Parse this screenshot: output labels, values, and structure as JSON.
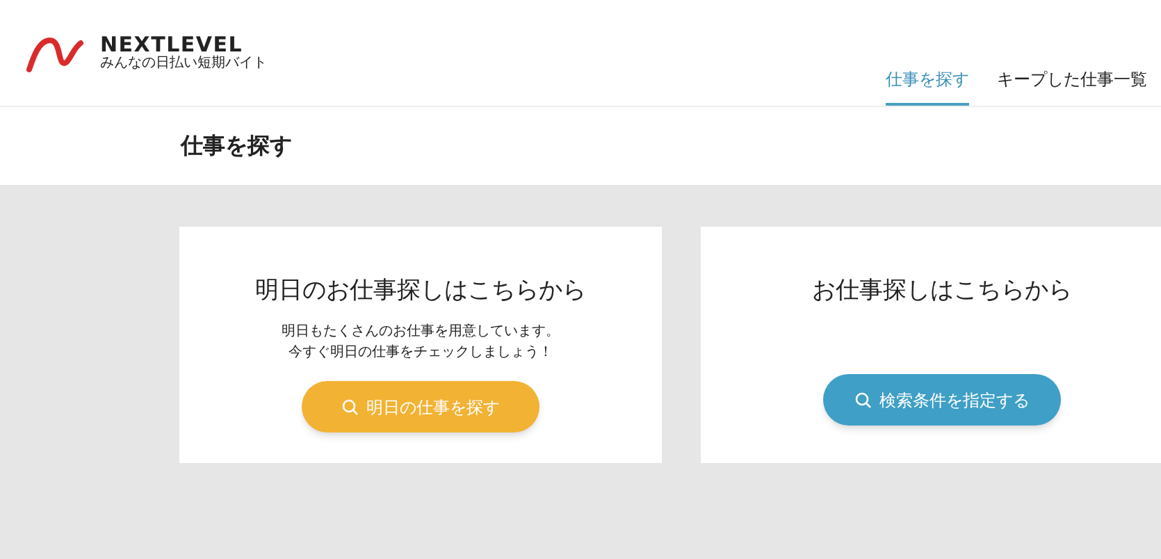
{
  "logo": {
    "name": "NEXTLEVEL",
    "tagline": "みんなの日払い短期バイト"
  },
  "nav": [
    {
      "label": "仕事を探す",
      "selected": true
    },
    {
      "label": "キープした仕事一覧",
      "selected": false
    }
  ],
  "page_title": "仕事を探す",
  "cards": [
    {
      "title": "明日のお仕事探しはこちらから",
      "lines": [
        "明日もたくさんのお仕事を用意しています。",
        "今すぐ明日の仕事をチェックしましょう！"
      ],
      "button": "明日の仕事を探す",
      "color": "#f2b234"
    },
    {
      "title": "お仕事探しはこちらから",
      "button": "検索条件を指定する",
      "color": "#3f9fc6"
    }
  ]
}
